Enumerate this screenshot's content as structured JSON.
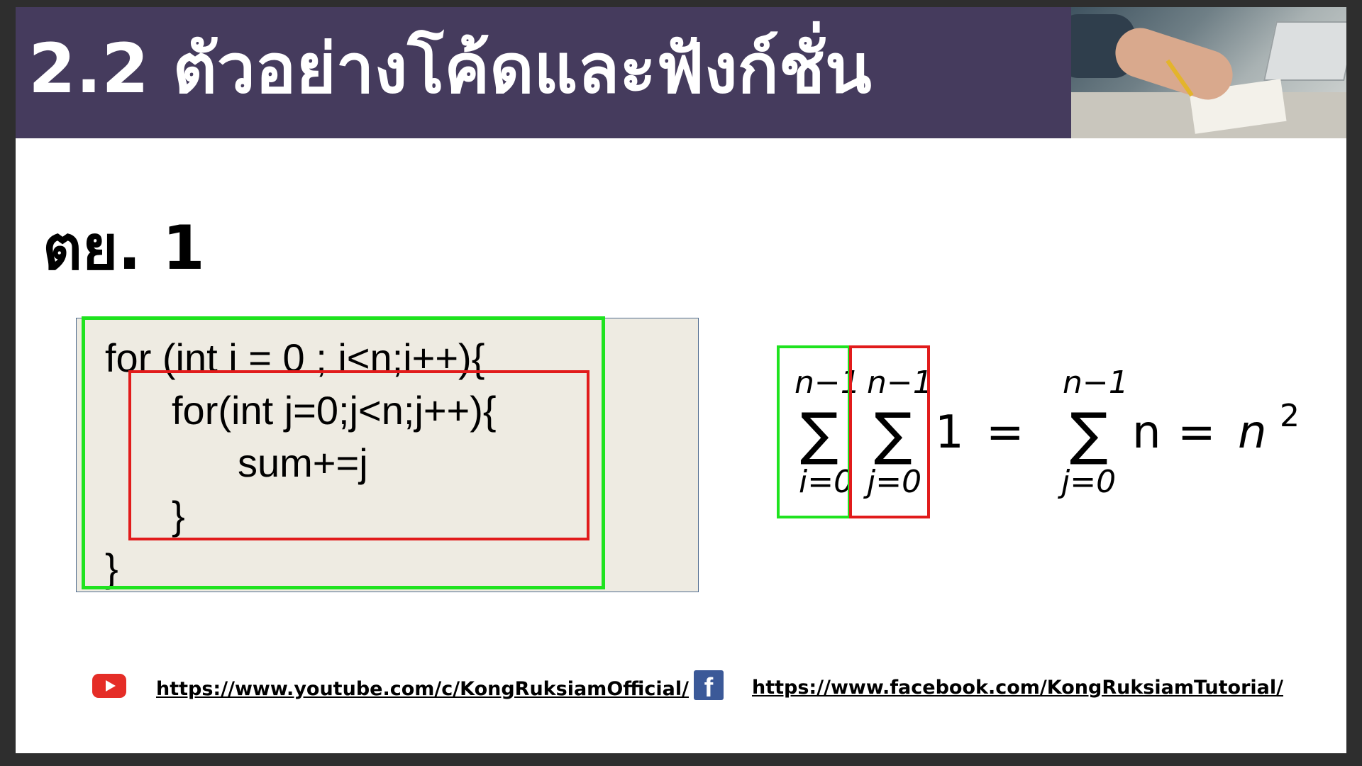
{
  "slide": {
    "title": "2.2 ตัวอย่างโค้ดและฟังก์ชั่น",
    "subtitle": "ตย. 1"
  },
  "code": {
    "lines": [
      "for (int i = 0 ; i<n;i++){",
      "for(int j=0;j<n;j++){",
      "sum+=j",
      "}",
      "}"
    ]
  },
  "formula": {
    "sigma": "∑",
    "outer_upper": "n−1",
    "outer_lower": "i=0",
    "inner_upper": "n−1",
    "inner_lower": "j=0",
    "summand": "1",
    "equals": "=",
    "second_upper": "n−1",
    "second_lower": "j=0",
    "second_summand": "n",
    "result_base": "n",
    "result_exp": "2"
  },
  "footer": {
    "youtube_url": "https://www.youtube.com/c/KongRuksiamOfficial/",
    "facebook_url": "https://www.facebook.com/KongRuksiamTutorial/",
    "facebook_glyph": "f"
  },
  "colors": {
    "title_bar": "#453b5d",
    "outer_loop_box": "#1fe31f",
    "inner_loop_box": "#e11b1b",
    "youtube": "#e52d27",
    "facebook": "#3b5998"
  }
}
